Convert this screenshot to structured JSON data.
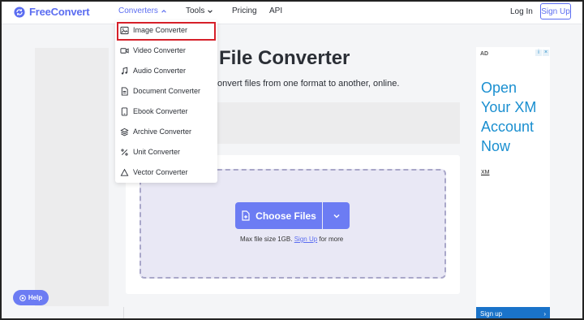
{
  "header": {
    "brand": "FreeConvert",
    "nav": [
      {
        "label": "Converters"
      },
      {
        "label": "Tools"
      },
      {
        "label": "Pricing"
      },
      {
        "label": "API"
      }
    ],
    "login": "Log In",
    "signup": "Sign Up",
    "accent_color": "#5b6df1"
  },
  "converters_menu": {
    "items": [
      {
        "label": "Image Converter",
        "icon": "image-icon"
      },
      {
        "label": "Video Converter",
        "icon": "video-icon"
      },
      {
        "label": "Audio Converter",
        "icon": "music-note-icon"
      },
      {
        "label": "Document Converter",
        "icon": "document-icon"
      },
      {
        "label": "Ebook Converter",
        "icon": "ebook-icon"
      },
      {
        "label": "Archive Converter",
        "icon": "layers-icon"
      },
      {
        "label": "Unit Converter",
        "icon": "percent-icon"
      },
      {
        "label": "Vector Converter",
        "icon": "triangle-icon"
      }
    ],
    "highlighted": "Image Converter",
    "highlight_color": "#d6202a"
  },
  "main": {
    "title": "File Converter",
    "subtitle": "onvert files from one format to another, online.",
    "choose_files": "Choose Files",
    "max_size_prefix": "Max file size 1GB.",
    "max_size_link": "Sign Up",
    "max_size_suffix": "for more",
    "button_color": "#6c7cf3"
  },
  "ad": {
    "label": "AD",
    "text_lines": [
      "Open",
      "Your XM",
      "Account",
      "Now"
    ],
    "brand": "XM",
    "cta": "Sign up",
    "cta_arrow": "›",
    "color": "#1a8fd0"
  },
  "help": {
    "label": "Help"
  }
}
